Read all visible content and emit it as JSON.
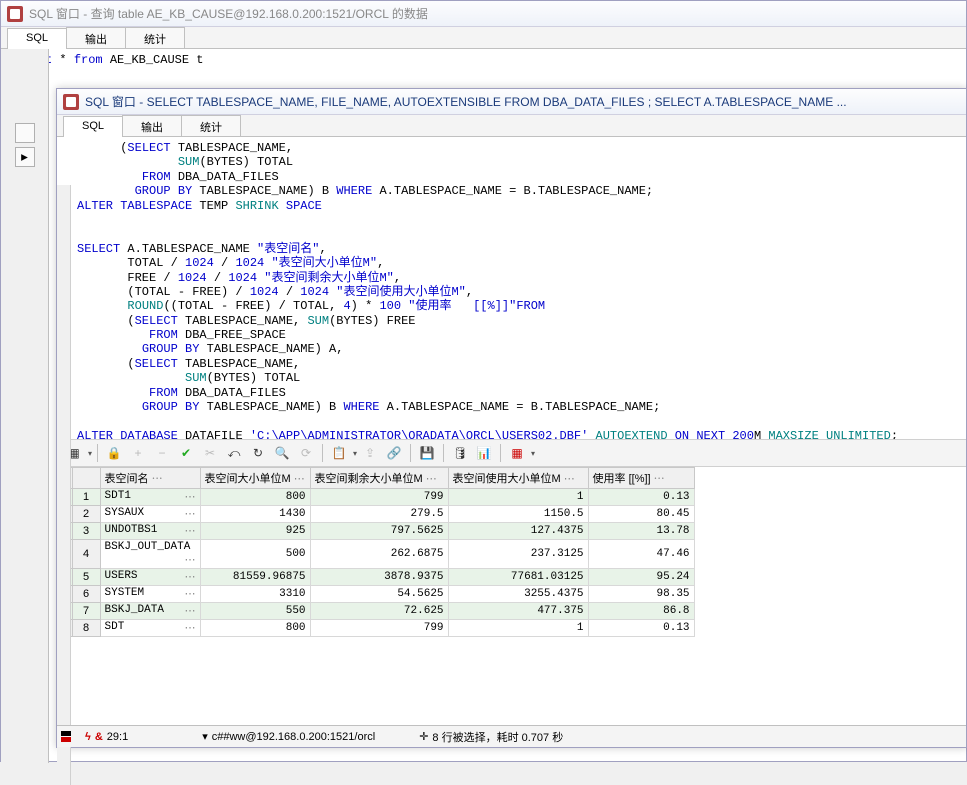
{
  "outer": {
    "title": "SQL 窗口 - 查询 table AE_KB_CAUSE@192.168.0.200:1521/ORCL 的数据",
    "tabs": [
      "SQL",
      "输出",
      "统计"
    ],
    "sql": "select * from AE_KB_CAUSE t"
  },
  "inner": {
    "title": "SQL 窗口 - SELECT TABLESPACE_NAME, FILE_NAME, AUTOEXTENSIBLE FROM DBA_DATA_FILES ; SELECT A.TABLESPACE_NAME ...",
    "tabs": [
      "SQL",
      "输出",
      "统计"
    ]
  },
  "grid": {
    "headers": [
      "表空间名",
      "表空间大小单位M",
      "表空间剩余大小单位M",
      "表空间使用大小单位M",
      "使用率   [[%]]"
    ],
    "rows": [
      {
        "n": "1",
        "name": "SDT1",
        "a": "800",
        "b": "799",
        "c": "1",
        "d": "0.13"
      },
      {
        "n": "2",
        "name": "SYSAUX",
        "a": "1430",
        "b": "279.5",
        "c": "1150.5",
        "d": "80.45"
      },
      {
        "n": "3",
        "name": "UNDOTBS1",
        "a": "925",
        "b": "797.5625",
        "c": "127.4375",
        "d": "13.78"
      },
      {
        "n": "4",
        "name": "BSKJ_OUT_DATA",
        "a": "500",
        "b": "262.6875",
        "c": "237.3125",
        "d": "47.46"
      },
      {
        "n": "5",
        "name": "USERS",
        "a": "81559.96875",
        "b": "3878.9375",
        "c": "77681.03125",
        "d": "95.24"
      },
      {
        "n": "6",
        "name": "SYSTEM",
        "a": "3310",
        "b": "54.5625",
        "c": "3255.4375",
        "d": "98.35"
      },
      {
        "n": "7",
        "name": "BSKJ_DATA",
        "a": "550",
        "b": "72.625",
        "c": "477.375",
        "d": "86.8"
      },
      {
        "n": "8",
        "name": "SDT",
        "a": "800",
        "b": "799",
        "c": "1",
        "d": "0.13"
      }
    ]
  },
  "status": {
    "pos": "29:1",
    "conn": "c##ww@192.168.0.200:1521/orcl",
    "msg": "8 行被选择，耗时 0.707 秒"
  },
  "icons": {
    "lock": "🔒",
    "plus": "+",
    "minus": "−",
    "check": "✔",
    "scissors": "✂",
    "undo": "⤺",
    "redo": "↻",
    "find": "🔍",
    "refresh": "⟳",
    "copy": "📋",
    "export": "⇪",
    "link": "🔗",
    "save": "💾",
    "db": "🛢",
    "chart": "📊",
    "grid": "▦",
    "crosshair": "✛",
    "amp": "&"
  }
}
